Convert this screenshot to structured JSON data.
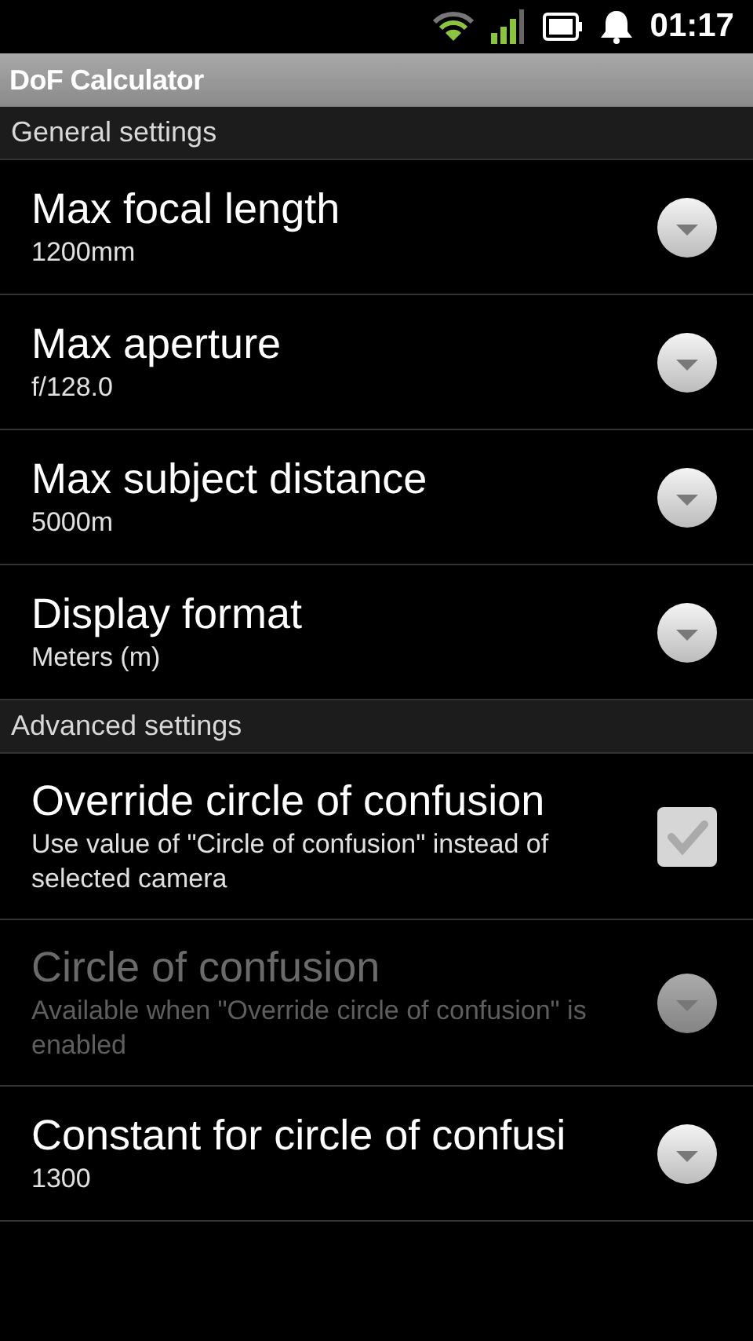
{
  "status_bar": {
    "time": "01:17"
  },
  "title_bar": {
    "title": "DoF Calculator"
  },
  "sections": [
    {
      "header": "General settings",
      "items": [
        {
          "kind": "dropdown",
          "title": "Max focal length",
          "summary": "1200mm",
          "disabled": false
        },
        {
          "kind": "dropdown",
          "title": "Max aperture",
          "summary": "f/128.0",
          "disabled": false
        },
        {
          "kind": "dropdown",
          "title": "Max subject distance",
          "summary": "5000m",
          "disabled": false
        },
        {
          "kind": "dropdown",
          "title": "Display format",
          "summary": "Meters (m)",
          "disabled": false
        }
      ]
    },
    {
      "header": "Advanced settings",
      "items": [
        {
          "kind": "checkbox",
          "title": "Override circle of confusion",
          "summary": "Use value of \"Circle of confusion\" instead of selected camera",
          "disabled": false,
          "checked": true
        },
        {
          "kind": "dropdown",
          "title": "Circle of confusion",
          "summary": "Available when \"Override circle of confusion\" is enabled",
          "disabled": true
        },
        {
          "kind": "dropdown",
          "title": "Constant for circle of confusi",
          "summary": "1300",
          "disabled": false
        }
      ]
    }
  ]
}
